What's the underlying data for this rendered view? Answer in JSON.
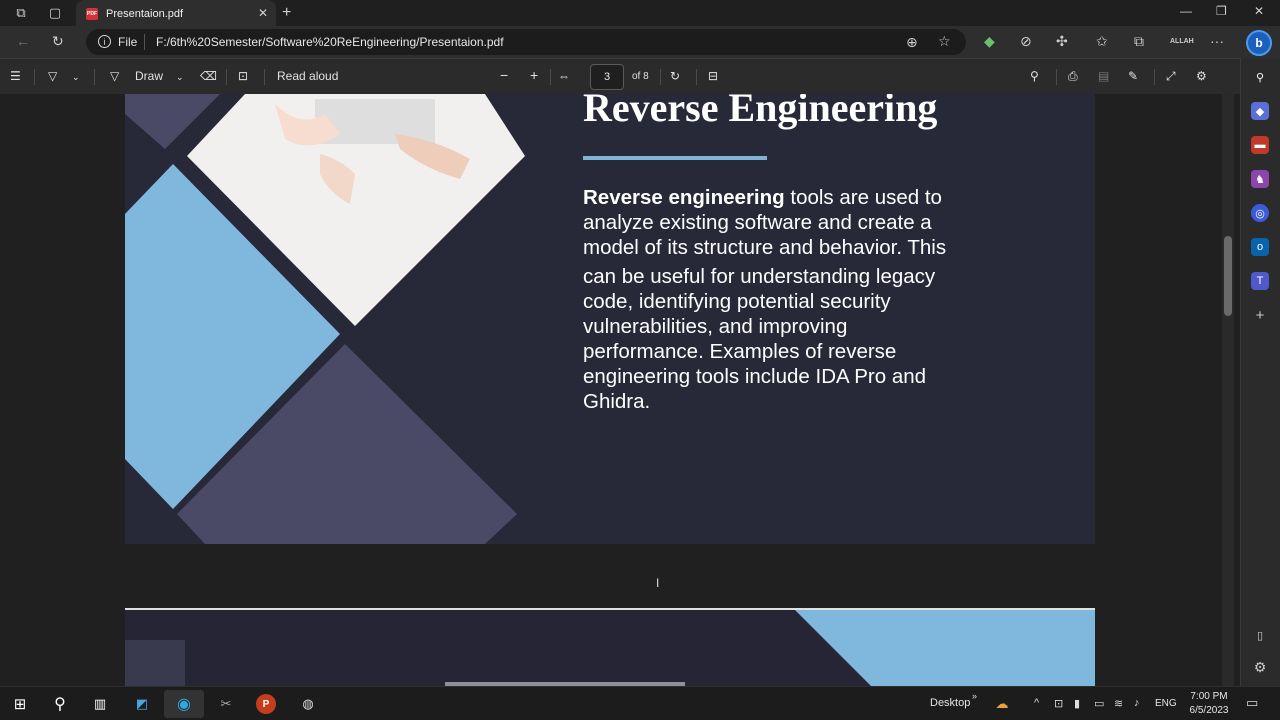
{
  "browser": {
    "tab_title": "Presentaion.pdf",
    "address_scheme": "File",
    "address_url": "F:/6th%20Semester/Software%20ReEngineering/Presentaion.pdf",
    "profile_label": "ALLAH"
  },
  "pdf_toolbar": {
    "draw_label": "Draw",
    "read_aloud_label": "Read aloud",
    "current_page": "3",
    "page_total_label": "of 8"
  },
  "slide": {
    "title": "Reverse Engineering",
    "body_bold": "Reverse engineering",
    "body_lines_first": " tools are used to",
    "body_line2": "analyze existing software and create a",
    "body_line3": "model of its structure and behavior. This",
    "body_line4": "can be useful for understanding legacy",
    "body_line5": "code, identifying potential security",
    "body_line6": "vulnerabilities, and improving",
    "body_line7": "performance. Examples of reverse",
    "body_line8": "engineering tools include IDA Pro and",
    "body_line9": "Ghidra.",
    "accent_color": "#7fb3d5",
    "background_color": "#272838"
  },
  "taskbar": {
    "desktop_label": "Desktop",
    "language": "ENG",
    "time": "7:00 PM",
    "date": "6/5/2023"
  },
  "icons": {
    "sidebar": [
      "search-icon",
      "tag-icon",
      "toolbox-icon",
      "games-icon",
      "office-icon",
      "outlook-icon",
      "teams-icon",
      "add-icon",
      "sidebar-toggle-icon",
      "settings-icon"
    ]
  }
}
